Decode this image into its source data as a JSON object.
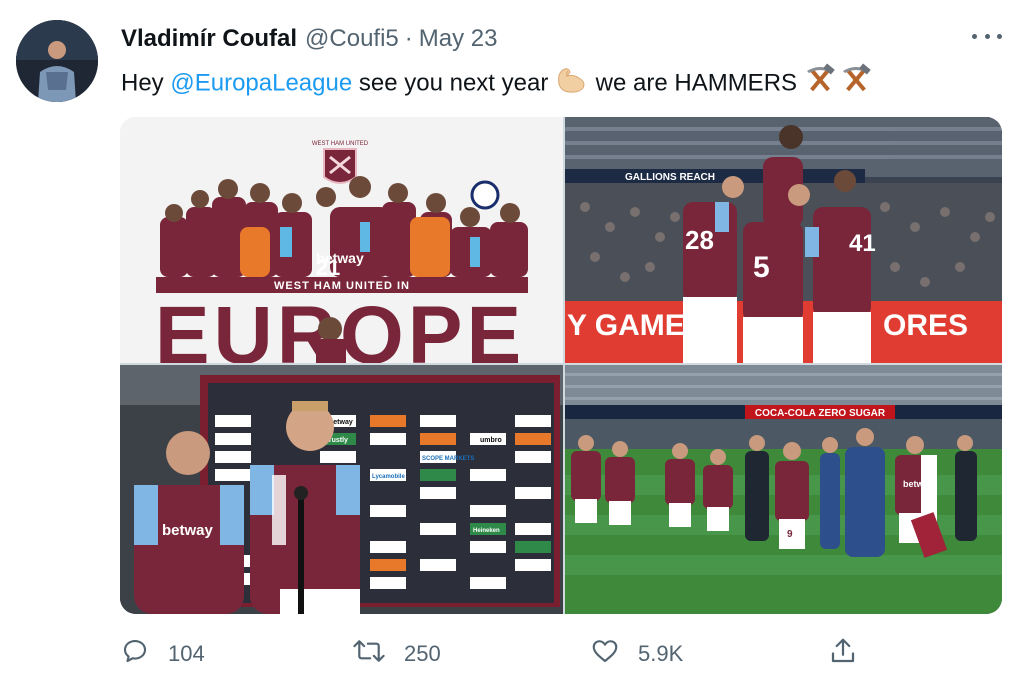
{
  "tweet": {
    "author_name": "Vladimír Coufal",
    "handle": "@Coufi5",
    "separator": "·",
    "date": "May 23",
    "text_prefix": "Hey ",
    "mention": "@EuropaLeague",
    "text_middle": " see you next year ",
    "text_suffix": " we are HAMMERS ",
    "emoji_1": "muscle-emoji",
    "emoji_2": "hammer-and-pick-emoji"
  },
  "media": {
    "photo1": {
      "crest_text": "WEST HAM UNITED",
      "banner_text": "WEST HAM UNITED IN",
      "big_text": "EUROPE",
      "shirt_text": "betway",
      "number": "21"
    },
    "photo2": {
      "board_text": "GALLIONS REACH",
      "ad_left": "Y GAMES",
      "ad_right": "ORES",
      "numbers": [
        "28",
        "5",
        "41"
      ]
    },
    "photo3": {
      "sponsors": [
        "betway",
        "SCOPE MARKETS",
        "umbro",
        "Heineken",
        "Lycamobile",
        "Trustly"
      ],
      "shirt_text": "betway"
    },
    "photo4": {
      "stand_text": "COCA-COLA ZERO SUGAR",
      "shirt_text": "betway",
      "number": "9"
    }
  },
  "actions": {
    "reply_count": "104",
    "retweet_count": "250",
    "like_count": "5.9K"
  },
  "colors": {
    "claret": "#7a263a",
    "blue": "#1bb1e7",
    "link": "#1d9bf0",
    "muted": "#536471"
  }
}
